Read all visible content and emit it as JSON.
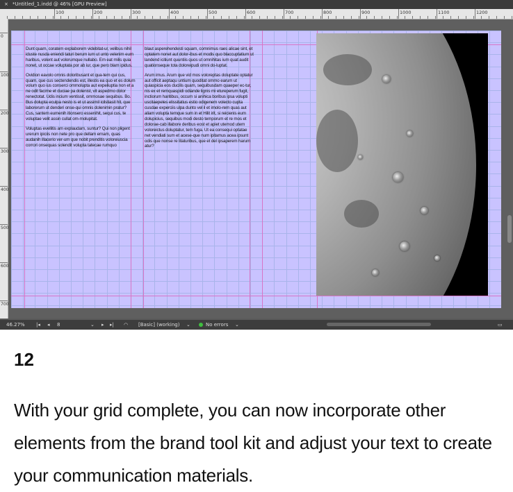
{
  "window": {
    "close_glyph": "×",
    "tab_title": "*Untitled_1.indd @ 46% [GPU Preview]"
  },
  "ruler": {
    "h_labels": [
      "100",
      "200",
      "300",
      "400",
      "500",
      "600",
      "700",
      "800",
      "900",
      "1000",
      "1100",
      "1200"
    ],
    "v_labels": [
      "0",
      "100",
      "200",
      "300",
      "400",
      "500",
      "600",
      "700"
    ]
  },
  "document": {
    "column1": [
      "Dunt quam, coratem explaborem videbitat-ur, velibus nihil iduste nusda eniendi taturi berum ium ut unto velenim eum haribus, volent aut volorumque nullabo. Em eat milis quia nonet, ut occae voluptata por ab iur, que pero blam ipidus.",
      "Ovidion eavolo omnis doloribusant et qua-tem qui cus, quam, que cus sectendendis est, illestis ea quo et es dolum volum quo ius conserci ommolupta aut expeliuptia non et a ne odit facime et duciae pa dolenist, vit aspedmo dolor renectotat. Udis incium ventissit, ommosae sequibus. Bo. Bus dolupta eculpa nesto is et ut assimil icilstiasit hit, que laborerum ut denderi onse-qui omnis dolenimin pratur? Cus, santem eumenih itionsero essenihit, sequi cus, te voluptae velit assin cullat om-molupitat.",
      "Voluptas evellitis am explaudam, suntur? Qui non pligent urerum ipiciis non nete pro que dellam ernam, quas audanih illacerio ver-um que nobit prenditis voloreiuscia corrori onsequas solendit volupta tatecae rumquo"
    ],
    "column2": [
      "blaut asperehendesti squam, comnimus raes alicae sint, et optatem nonet aut dolor-ibus et modis quo blaccuptatium ut landend icitiunt quuntiis quos ut omnihitas ium quat audit quationseque tota doloreipudi omni do-luptat.",
      "Arum imus. Arum que vid mos voloreptas doluptate optatur aut officit aeptaqu untium quoditat ommo earum ut quiaspicia eos ducilis quam, sequibusdam quaeper ec-tur, nis ex et remquaspidi odiande lignis mi etureperum fugit, inctiorum haritibus, occum si anihica boribus ipsa volupti uscitaepeles elissitatius estio odigenem volecto cupta cusdae experciis ulpa dunto vel il et imolo-rem quas aut aliam volupta temque sum in et Hilit irit, si reicienis eum dolupicius, sequibus modi desto temporum et re mos et dolorae-cab illabore deribus eost et apiet utemod utem voloreictus doluptatur, tem fuga. Ut ea consequi optatae net vendiati sum et acese-que num ipitamus acea ipsunt odis que nonse re litaturibus, que et del ipsaperem harum atur?"
    ]
  },
  "status_bar": {
    "zoom": "46.27%",
    "first_page": "|◂",
    "prev_page": "◂",
    "page_number": "8",
    "page_dropdown": "⌄",
    "next_page": "▸",
    "last_page": "▸|",
    "preview_glyph": "◠",
    "preflight_profile": "[Basic] (working)",
    "profile_dropdown": "⌄",
    "errors": "No errors",
    "errors_dropdown": "⌄",
    "layout_glyph": "▭"
  },
  "caption": {
    "step": "12",
    "text": "With your grid complete, you can now incorporate other elements from the brand tool kit and adjust your text to create your communication materials."
  }
}
